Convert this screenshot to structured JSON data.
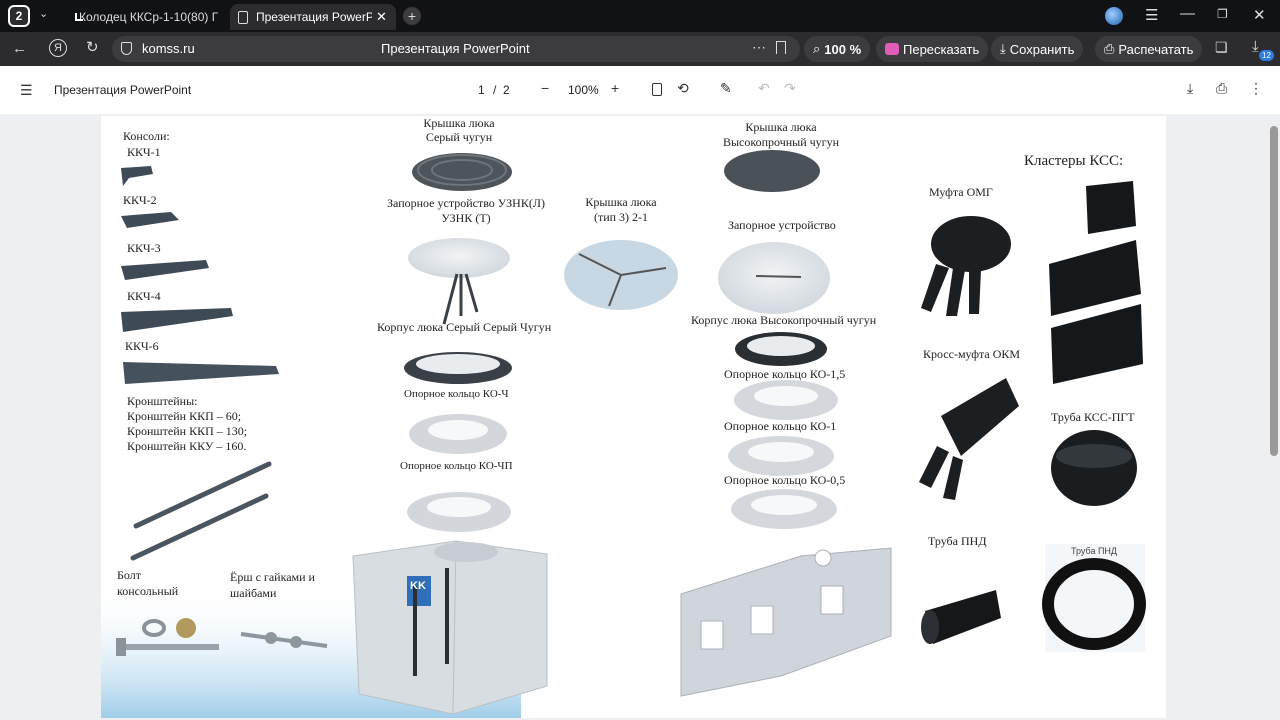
{
  "browser": {
    "tab_counter": "2",
    "tabs": [
      {
        "title": "Колодец ККСр-1-10(80) Г"
      },
      {
        "title": "Презентация PowerPoint"
      }
    ],
    "address": "komss.ru",
    "page_title": "Презентация PowerPoint",
    "zoom": "100 %",
    "summarize": "Пересказать",
    "save": "Сохранить",
    "print": "Распечатать",
    "downloads_badge": "12"
  },
  "pdf": {
    "title": "Презентация PowerPoint",
    "page_current": "1",
    "page_sep": "/",
    "page_total": "2",
    "zoom": "100%"
  },
  "slide": {
    "consoles_header": "Консоли:",
    "kkch1": "ККЧ-1",
    "kkch2": "ККЧ-2",
    "kkch3": "ККЧ-3",
    "kkch4": "ККЧ-4",
    "kkch6": "ККЧ-6",
    "brackets": [
      "Кронштейны:",
      "Кронштейн ККП – 60;",
      "Кронштейн ККП – 130;",
      "Кронштейн ККУ – 160."
    ],
    "bolt": [
      "Болт",
      "консольный"
    ],
    "ersh": [
      "Ёрш с гайками и",
      "шайбами"
    ],
    "lid_grey": [
      "Крышка люка",
      "Серый чугун"
    ],
    "lock_uznk": [
      "Запорное устройство УЗНК(Л)",
      "УЗНК (Т)"
    ],
    "body_grey": "Корпус люка Серый Серый Чугун",
    "ring_ko_ch": "Опорное кольцо КО-Ч",
    "ring_ko_chp": "Опорное кольцо КО-ЧП",
    "lid_type3": [
      "Крышка люка",
      "(тип 3) 2-1"
    ],
    "lid_hs": [
      "Крышка люка",
      "Высокопрочный  чугун"
    ],
    "lock": "Запорное устройство",
    "body_hs": "Корпус люка Высокопрочный чугун",
    "ring_15": "Опорное кольцо КО-1,5",
    "ring_1": "Опорное кольцо КО-1",
    "ring_05": "Опорное кольцо КО-0,5",
    "clusters": "Кластеры КСС:",
    "omg": "Муфта ОМГ",
    "okm": "Кросс-муфта ОКМ",
    "kss_pgt": "Труба КСС-ПГТ",
    "pnd": "Труба ПНД",
    "pnd_photo_label": "Труба ПНД",
    "logo_letters": "KK"
  }
}
